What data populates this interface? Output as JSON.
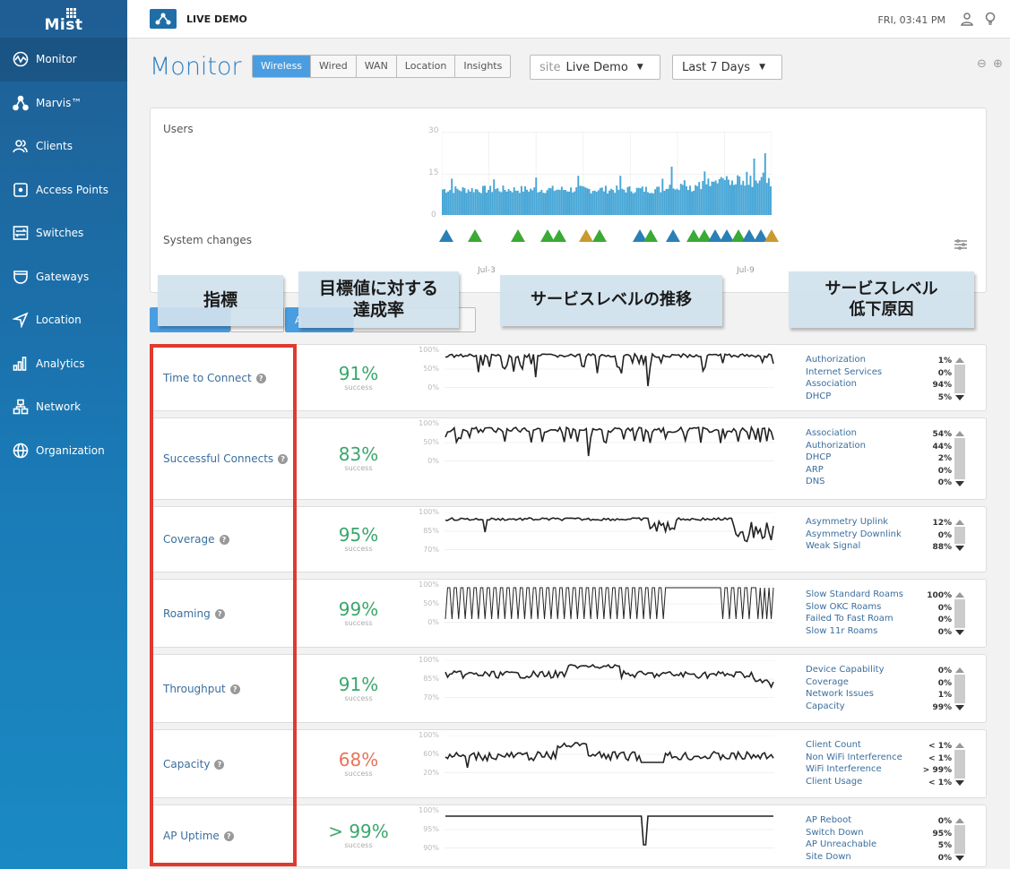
{
  "sidebar": {
    "logo": "Mist",
    "items": [
      {
        "label": "Monitor",
        "icon": "monitor-icon",
        "active": true
      },
      {
        "label": "Marvis™",
        "icon": "marvis-icon"
      },
      {
        "label": "Clients",
        "icon": "clients-icon"
      },
      {
        "label": "Access Points",
        "icon": "access-point-icon"
      },
      {
        "label": "Switches",
        "icon": "switch-icon"
      },
      {
        "label": "Gateways",
        "icon": "gateway-icon"
      },
      {
        "label": "Location",
        "icon": "location-icon"
      },
      {
        "label": "Analytics",
        "icon": "analytics-icon"
      },
      {
        "label": "Network",
        "icon": "network-icon"
      },
      {
        "label": "Organization",
        "icon": "organization-icon"
      }
    ]
  },
  "header": {
    "org_name": "LIVE DEMO",
    "clock": "FRI, 03:41 PM"
  },
  "page": {
    "title": "Monitor",
    "tabs": [
      "Wireless",
      "Wired",
      "WAN",
      "Location",
      "Insights"
    ],
    "active_tab": "Wireless",
    "site_prefix": "site",
    "site_value": "Live Demo",
    "time_range": "Last 7 Days"
  },
  "users_chart": {
    "label": "Users",
    "system_changes_label": "System changes",
    "y_ticks": [
      "30",
      "15",
      "0"
    ],
    "dates": [
      "Jul-3",
      "Jul-9"
    ],
    "colors": {
      "bar": "#47a6d6",
      "blue": "#2a7fb6",
      "green": "#3aaa35",
      "gold": "#c99a2e"
    }
  },
  "annotations": {
    "metric": "指標",
    "rate": "目標値に対する達成率",
    "trend": "サービスレベルの推移",
    "cause": "サービスレベル低下原因"
  },
  "metrics": [
    {
      "name": "Time to Connect",
      "pct": "91%",
      "sub": "success",
      "color": "#3aa66b",
      "axis": [
        "100%",
        "50%",
        "0%"
      ],
      "classifiers": [
        [
          "Authorization",
          "1%"
        ],
        [
          "Internet Services",
          "0%"
        ],
        [
          "Association",
          "94%"
        ],
        [
          "DHCP",
          "5%"
        ]
      ]
    },
    {
      "name": "Successful Connects",
      "pct": "83%",
      "sub": "success",
      "color": "#3aa66b",
      "axis": [
        "100%",
        "50%",
        "0%"
      ],
      "classifiers": [
        [
          "Association",
          "54%"
        ],
        [
          "Authorization",
          "44%"
        ],
        [
          "DHCP",
          "2%"
        ],
        [
          "ARP",
          "0%"
        ],
        [
          "DNS",
          "0%"
        ]
      ]
    },
    {
      "name": "Coverage",
      "pct": "95%",
      "sub": "success",
      "color": "#3aa66b",
      "axis": [
        "100%",
        "85%",
        "70%"
      ],
      "classifiers": [
        [
          "Asymmetry Uplink",
          "12%"
        ],
        [
          "Asymmetry Downlink",
          "0%"
        ],
        [
          "Weak Signal",
          "88%"
        ]
      ]
    },
    {
      "name": "Roaming",
      "pct": "99%",
      "sub": "success",
      "color": "#3aa66b",
      "axis": [
        "100%",
        "50%",
        "0%"
      ],
      "classifiers": [
        [
          "Slow Standard Roams",
          "100%"
        ],
        [
          "Slow OKC Roams",
          "0%"
        ],
        [
          "Failed To Fast Roam",
          "0%"
        ],
        [
          "Slow 11r Roams",
          "0%"
        ]
      ]
    },
    {
      "name": "Throughput",
      "pct": "91%",
      "sub": "success",
      "color": "#3aa66b",
      "axis": [
        "100%",
        "85%",
        "70%"
      ],
      "classifiers": [
        [
          "Device Capability",
          "0%"
        ],
        [
          "Coverage",
          "0%"
        ],
        [
          "Network Issues",
          "1%"
        ],
        [
          "Capacity",
          "99%"
        ]
      ]
    },
    {
      "name": "Capacity",
      "pct": "68%",
      "sub": "success",
      "color": "#e8735a",
      "axis": [
        "100%",
        "60%",
        "20%"
      ],
      "classifiers": [
        [
          "Client Count",
          "< 1%"
        ],
        [
          "Non WiFi Interference",
          "< 1%"
        ],
        [
          "WiFi Interference",
          "> 99%"
        ],
        [
          "Client Usage",
          "< 1%"
        ]
      ]
    },
    {
      "name": "AP Uptime",
      "pct": "> 99%",
      "sub": "success",
      "color": "#3aa66b",
      "axis": [
        "100%",
        "95%",
        "90%"
      ],
      "classifiers": [
        [
          "AP Reboot",
          "0%"
        ],
        [
          "Switch Down",
          "95%"
        ],
        [
          "AP Unreachable",
          "5%"
        ],
        [
          "Site Down",
          "0%"
        ]
      ]
    }
  ],
  "subtab_label": "A"
}
